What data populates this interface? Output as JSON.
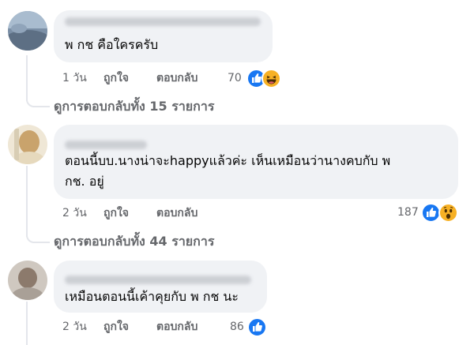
{
  "comments": [
    {
      "text": "พ กช คือใครครับ",
      "time": "1 วัน",
      "like_label": "ถูกใจ",
      "reply_label": "ตอบกลับ",
      "reaction_count": "70",
      "reactions": [
        "like-icon",
        "laughing-emoji-icon"
      ],
      "view_replies": "ดูการตอบกลับทั้ง 15 รายการ"
    },
    {
      "text": "ตอนนี้บบ.นางน่าจะhappyแล้วค่ะ เห็นเหมือนว่านางคบกับ พ\nกช. อยู่",
      "time": "2 วัน",
      "like_label": "ถูกใจ",
      "reply_label": "ตอบกลับ",
      "reaction_count": "187",
      "reactions": [
        "like-icon",
        "wow-emoji-icon"
      ],
      "view_replies": "ดูการตอบกลับทั้ง 44 รายการ"
    },
    {
      "text": "เหมือนตอนนี้เค้าคุยกับ พ กช นะ",
      "time": "2 วัน",
      "like_label": "ถูกใจ",
      "reply_label": "ตอบกลับ",
      "reaction_count": "86",
      "reactions": [
        "like-icon"
      ]
    }
  ],
  "colors": {
    "bubble": "#f0f2f5",
    "meta_text": "#65676b",
    "like_blue": "#1877f2",
    "emoji_yellow": "#f7b125"
  }
}
